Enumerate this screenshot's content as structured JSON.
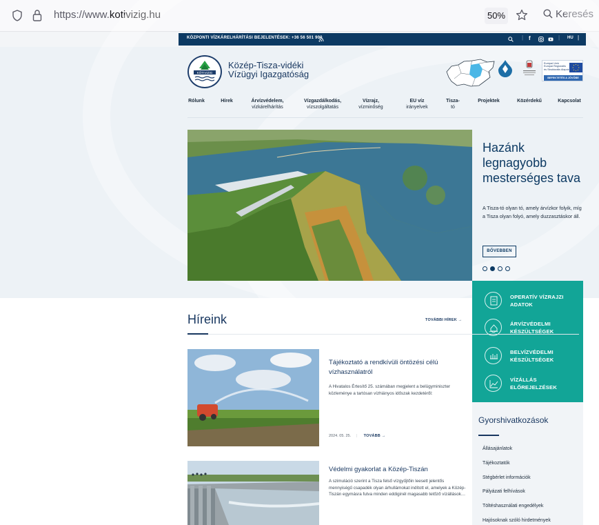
{
  "browser": {
    "url_prefix": "https://www.",
    "url_domain": "kotivizig.hu",
    "zoom": "50%",
    "search_label": "Keresés"
  },
  "topbar": {
    "hotline": "KÖZPONTI VÍZKÁRELHÁRÍTÁSI BEJELENTÉSEK: +36 56 501 900",
    "lang": "HU"
  },
  "header": {
    "logo_text": "KÖTIVIZIG",
    "title_line1": "Közép-Tisza-vidéki",
    "title_line2": "Vízügyi Igazgatóság",
    "eu_line1": "Európai Unió",
    "eu_line2": "Európai Regionális",
    "eu_line3": "és Strukturális Alapok",
    "eu_slogan": "BEFEKTETÉS A JÖVŐBE"
  },
  "nav": [
    {
      "l1": "Rólunk",
      "l2": ""
    },
    {
      "l1": "Hírek",
      "l2": ""
    },
    {
      "l1": "Árvízvédelem,",
      "l2": "vízkárelhárítás"
    },
    {
      "l1": "Vízgazdálkodás,",
      "l2": "vízszolgáltatás"
    },
    {
      "l1": "Vízrajz,",
      "l2": "vízminőség"
    },
    {
      "l1": "EU víz",
      "l2": "irányelvek"
    },
    {
      "l1": "Tisza-",
      "l2": "tó"
    },
    {
      "l1": "Projektek",
      "l2": ""
    },
    {
      "l1": "Közérdekű",
      "l2": ""
    },
    {
      "l1": "Kapcsolat",
      "l2": ""
    }
  ],
  "hero": {
    "title": "Hazánk legnagyobb mesterséges tava",
    "text": "A Tisza-tó olyan tó, amely árvízkor folyik, míg a Tisza olyan folyó, amely duzzasztáskor áll.",
    "button": "BŐVEBBEN",
    "slide_count": 4,
    "active_slide": 2
  },
  "quick": [
    {
      "l1": "OPERATÍV VÍZRAJZI",
      "l2": "ADATOK",
      "icon": "document-icon"
    },
    {
      "l1": "ÁRVÍZVÉDELMI",
      "l2": "KÉSZÜLTSÉGEK",
      "icon": "wave-house-icon"
    },
    {
      "l1": "BELVÍZVÉDELMI",
      "l2": "KÉSZÜLTSÉGEK",
      "icon": "field-icon"
    },
    {
      "l1": "VÍZÁLLÁS",
      "l2": "ELŐREJELZÉSEK",
      "icon": "chart-icon"
    }
  ],
  "links": {
    "title": "Gyorshivatkozások",
    "items": [
      "Állásajánlatok",
      "Tájékoztatók",
      "Stégbérlet információk",
      "Pályázati felhívások",
      "Töltéshasználati engedélyek",
      "Hajósoknak szóló hirdetmények"
    ]
  },
  "news": {
    "heading": "Híreink",
    "more": "TOVÁBBI HÍREK",
    "items": [
      {
        "title": "Tájékoztató a rendkívüli öntözési célú vízhasználatról",
        "text": "A Hivatalos Értesítő 25. számában megjelent a belügyminiszter közleménye a tartósan vízhiányos időszak kezdetéről:",
        "date": "2024. 05. 25.",
        "more": "TOVÁBB"
      },
      {
        "title": "Védelmi gyakorlat a Közép-Tiszán",
        "text": "A szimuláció szerint a Tisza felső vízgyűjtőin leesett jelentős mennyiségű csapadék olyan árhullámokat indított el, amelyek a Közép-Tiszán egymásra futva minden eddiginél magasabb tetőző vízállások…",
        "date": "",
        "more": ""
      }
    ]
  },
  "colors": {
    "navy": "#0d3a63",
    "teal": "#12a597",
    "panel": "#edf2f6"
  }
}
